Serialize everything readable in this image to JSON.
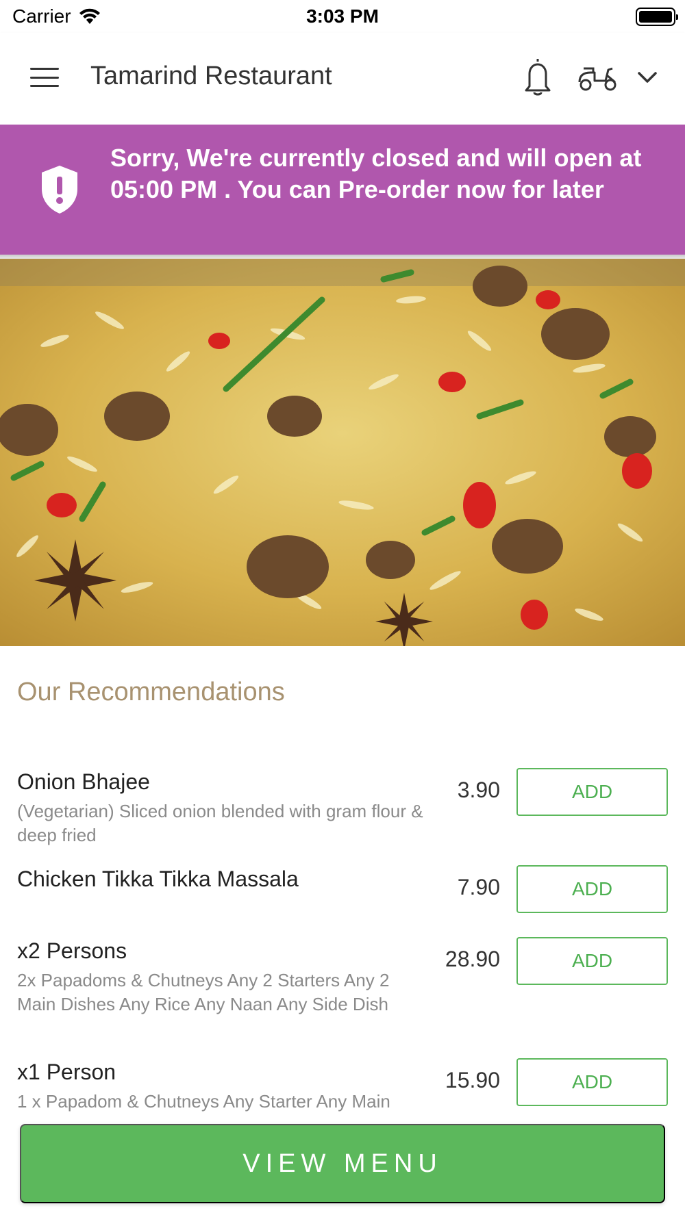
{
  "status_bar": {
    "carrier": "Carrier",
    "time": "3:03 PM",
    "battery_level": 1.0
  },
  "header": {
    "title": "Tamarind Restaurant",
    "icons": [
      "menu-icon",
      "bell-icon",
      "scooter-icon",
      "chevron-down-icon"
    ]
  },
  "banner": {
    "message": "Sorry, We're currently closed and will open at 05:00 PM . You can Pre-order now for later",
    "icon": "shield-alert-icon",
    "color": "#b057ad"
  },
  "hero": {
    "image": "biryani-rice-dish-photo"
  },
  "recommendations": {
    "title": "Our Recommendations",
    "items": [
      {
        "name": "Onion Bhajee",
        "description": "(Vegetarian) Sliced onion blended with gram flour & deep fried",
        "price": "3.90",
        "button": "ADD"
      },
      {
        "name": "Chicken Tikka Tikka Massala",
        "description": "",
        "price": "7.90",
        "button": "ADD"
      },
      {
        "name": "x2 Persons",
        "description": "2x Papadoms & Chutneys  Any 2 Starters  Any 2 Main Dishes  Any Rice  Any Naan  Any Side Dish",
        "price": "28.90",
        "button": "ADD"
      },
      {
        "name": "x1 Person",
        "description": "1 x Papadom & Chutneys  Any Starter  Any Main",
        "price": "15.90",
        "button": "ADD"
      }
    ]
  },
  "footer": {
    "view_menu_label": "VIEW MENU",
    "button_color": "#5cb85c"
  },
  "colors": {
    "accent_green": "#5cb85c",
    "section_title": "#a89270",
    "description_gray": "#8a8a8a"
  }
}
